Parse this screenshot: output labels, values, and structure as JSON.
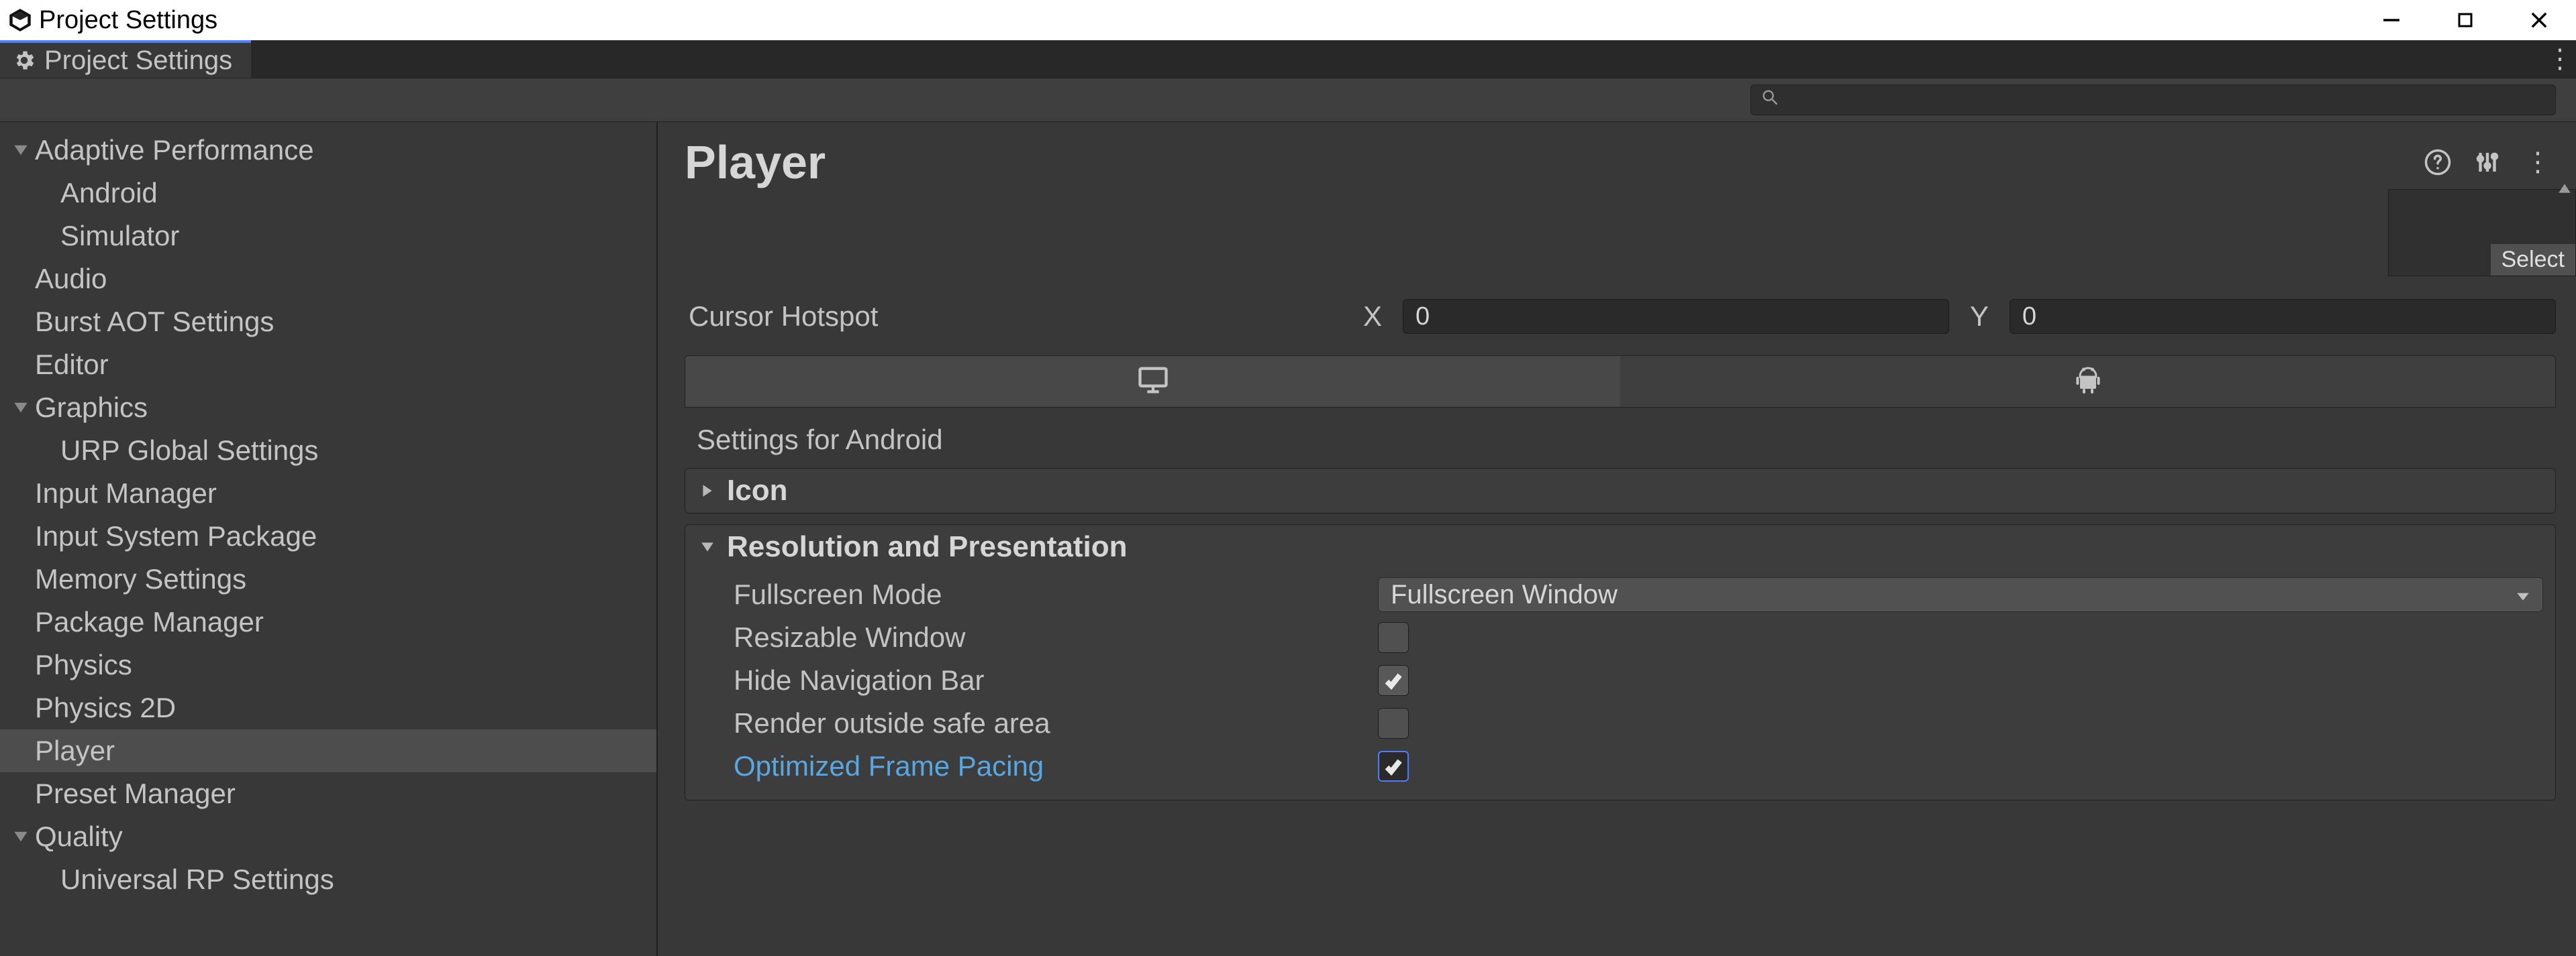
{
  "window_title": "Project Settings",
  "tab_title": "Project Settings",
  "search_placeholder": "",
  "sidebar": {
    "items": [
      {
        "label": "Adaptive Performance",
        "depth": 0,
        "arrow": "down"
      },
      {
        "label": "Android",
        "depth": 1
      },
      {
        "label": "Simulator",
        "depth": 1
      },
      {
        "label": "Audio",
        "depth": 0
      },
      {
        "label": "Burst AOT Settings",
        "depth": 0
      },
      {
        "label": "Editor",
        "depth": 0
      },
      {
        "label": "Graphics",
        "depth": 0,
        "arrow": "down"
      },
      {
        "label": "URP Global Settings",
        "depth": 1
      },
      {
        "label": "Input Manager",
        "depth": 0
      },
      {
        "label": "Input System Package",
        "depth": 0
      },
      {
        "label": "Memory Settings",
        "depth": 0
      },
      {
        "label": "Package Manager",
        "depth": 0
      },
      {
        "label": "Physics",
        "depth": 0
      },
      {
        "label": "Physics 2D",
        "depth": 0
      },
      {
        "label": "Player",
        "depth": 0,
        "selected": true
      },
      {
        "label": "Preset Manager",
        "depth": 0
      },
      {
        "label": "Quality",
        "depth": 0,
        "arrow": "down"
      },
      {
        "label": "Universal RP Settings",
        "depth": 1
      }
    ]
  },
  "main": {
    "title": "Player",
    "select_label": "Select",
    "cursor_hotspot_label": "Cursor Hotspot",
    "x_label": "X",
    "y_label": "Y",
    "x_value": "0",
    "y_value": "0",
    "platform_caption": "Settings for Android",
    "sections": {
      "icon_label": "Icon",
      "res_label": "Resolution and Presentation"
    },
    "resolution": {
      "fullscreen_mode_label": "Fullscreen Mode",
      "fullscreen_mode_value": "Fullscreen Window",
      "resizable_window_label": "Resizable Window",
      "resizable_window_checked": false,
      "hide_nav_label": "Hide Navigation Bar",
      "hide_nav_checked": true,
      "render_safe_label": "Render outside safe area",
      "render_safe_checked": false,
      "optimized_pacing_label": "Optimized Frame Pacing",
      "optimized_pacing_checked": true
    }
  }
}
